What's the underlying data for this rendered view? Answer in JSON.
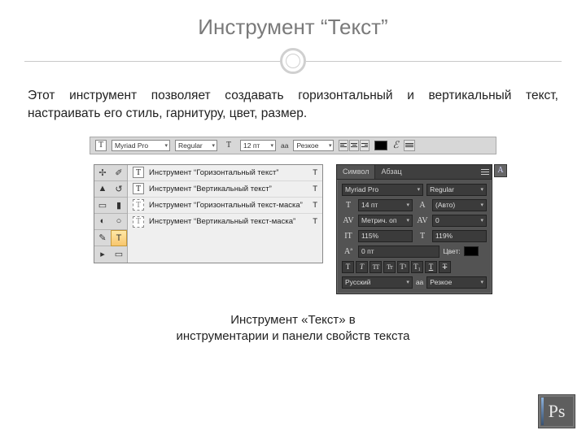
{
  "title": "Инструмент “Текст”",
  "intro": "Этот инструмент позволяет создавать горизонтальный и вертикальный текст, настраивать его стиль, гарнитуру, цвет, размер.",
  "optbar": {
    "font": "Myriad Pro",
    "style": "Regular",
    "sizeLabel": "T",
    "size": "12 пт",
    "aaLabel": "aa",
    "aa": "Резкое",
    "warp": "ℰ"
  },
  "tools": {
    "flyout": [
      {
        "icon": "T",
        "label": "Инструмент “Горизонтальный текст”",
        "key": "T",
        "dashed": false
      },
      {
        "icon": "T",
        "label": "Инструмент “Вертикальный текст”",
        "key": "T",
        "dashed": false
      },
      {
        "icon": "T",
        "label": "Инструмент “Горизонтальный текст-маска”",
        "key": "T",
        "dashed": true
      },
      {
        "icon": "T",
        "label": "Инструмент “Вертикальный текст-маска”",
        "key": "T",
        "dashed": true
      }
    ]
  },
  "charPanel": {
    "tabActive": "Символ",
    "tabOther": "Абзац",
    "font": "Myriad Pro",
    "style": "Regular",
    "size": "14 пт",
    "leading": "(Авто)",
    "tracking": "Метрич. оп",
    "kerning": "0",
    "hscale": "115%",
    "vscale": "119%",
    "baseline": "0 пт",
    "colorLabel": "Цвет:",
    "lang": "Русский",
    "aaLabel": "aa",
    "aa": "Резкое",
    "sideLetter": "A"
  },
  "caption_l1": "Инструмент «Текст» в",
  "caption_l2": "инструментарии и панели свойств текста",
  "badge": "Ps"
}
